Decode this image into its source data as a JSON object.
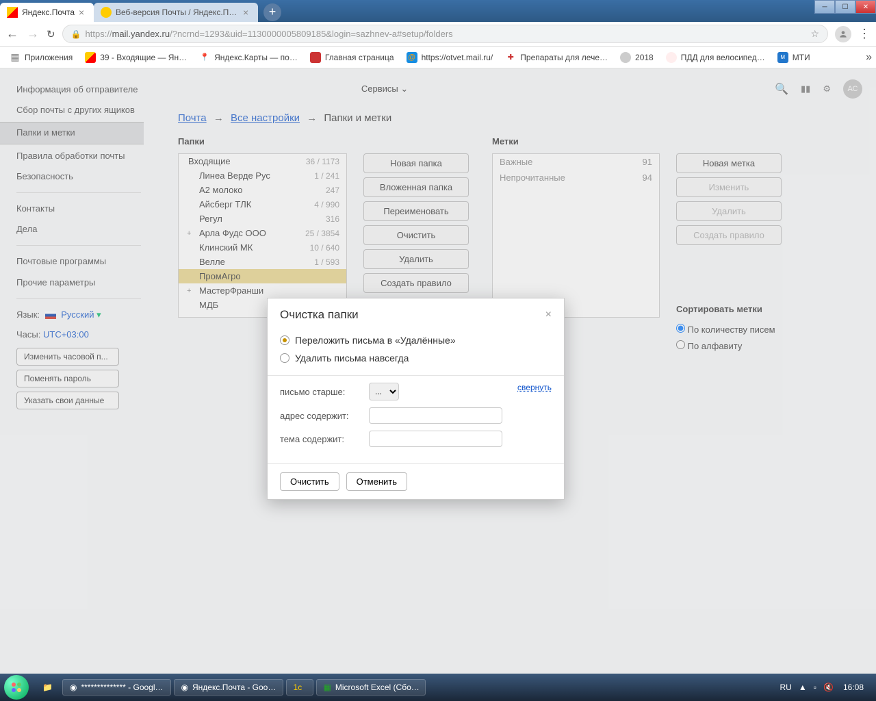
{
  "browser": {
    "tabs": [
      {
        "title": "Яндекс.Почта",
        "active": true
      },
      {
        "title": "Веб-версия Почты / Яндекс.По…",
        "active": false
      }
    ],
    "url_prefix": "https://",
    "url_host": "mail.yandex.ru",
    "url_path": "/?ncrnd=1293&uid=1130000005809185&login=sazhnev-a#setup/folders",
    "bookmarks_label": "Приложения",
    "bookmarks": [
      {
        "label": "39 - Входящие — Ян…"
      },
      {
        "label": "Яндекс.Карты — по…"
      },
      {
        "label": "Главная страница"
      },
      {
        "label": "https://otvet.mail.ru/"
      },
      {
        "label": "Препараты для лече…"
      },
      {
        "label": "2018"
      },
      {
        "label": "ПДД для велосипед…"
      },
      {
        "label": "МТИ"
      }
    ]
  },
  "topbar": {
    "services": "Сервисы",
    "avatar": "АС"
  },
  "breadcrumb": {
    "mail": "Почта",
    "all_settings": "Все настройки",
    "current": "Папки и метки"
  },
  "sidebar": {
    "items": [
      "Информация об отправителе",
      "Сбор почты с других ящиков",
      "Папки и метки",
      "Правила обработки почты",
      "Безопасность",
      "Контакты",
      "Дела",
      "Почтовые программы",
      "Прочие параметры"
    ],
    "lang_label": "Язык:",
    "lang_value": "Русский",
    "clock_label": "Часы:",
    "clock_value": "UTC+03:00",
    "btn_tz": "Изменить часовой п...",
    "btn_pass": "Поменять пароль",
    "btn_data": "Указать свои данные"
  },
  "sections": {
    "folders": "Папки",
    "labels": "Метки",
    "sort_title": "Сортировать метки",
    "sort_by_count": "По количеству писем",
    "sort_alpha": "По алфавиту"
  },
  "folder_buttons": [
    "Новая папка",
    "Вложенная папка",
    "Переименовать",
    "Очистить",
    "Удалить",
    "Создать правило"
  ],
  "label_buttons": [
    "Новая метка",
    "Изменить",
    "Удалить",
    "Создать правило"
  ],
  "folders": [
    {
      "name": "Входящие",
      "count": "36 / 1173",
      "level": 0
    },
    {
      "name": "Линеа Верде Рус",
      "count": "1 / 241",
      "level": 1
    },
    {
      "name": "А2 молоко",
      "count": "247",
      "level": 1
    },
    {
      "name": "Айсберг ТЛК",
      "count": "4 / 990",
      "level": 1
    },
    {
      "name": "Регул",
      "count": "316",
      "level": 1
    },
    {
      "name": "Арла Фудс ООО",
      "count": "25 / 3854",
      "level": 1,
      "expand": "+"
    },
    {
      "name": "Клинский МК",
      "count": "10 / 640",
      "level": 1
    },
    {
      "name": "Велле",
      "count": "1 / 593",
      "level": 1
    },
    {
      "name": "ПромАгро",
      "count": "",
      "level": 1,
      "selected": true
    },
    {
      "name": "МастерФранши",
      "count": "",
      "level": 1,
      "expand": "+"
    },
    {
      "name": "МДБ",
      "count": "",
      "level": 1
    }
  ],
  "labels": [
    {
      "name": "Важные",
      "count": "91"
    },
    {
      "name": "Непрочитанные",
      "count": "94"
    }
  ],
  "modal": {
    "title": "Очистка папки",
    "opt_move": "Переложить письма в «Удалённые»",
    "opt_delete": "Удалить письма навсегда",
    "collapse": "свернуть",
    "older_than": "письмо старше:",
    "older_val": "...",
    "addr_contains": "адрес содержит:",
    "subj_contains": "тема содержит:",
    "btn_clean": "Очистить",
    "btn_cancel": "Отменить"
  },
  "taskbar": {
    "items": [
      "************** - Googl…",
      "Яндекс.Почта - Goo…",
      "",
      "Microsoft Excel (Сбо…"
    ],
    "lang": "RU",
    "time": "16:08"
  }
}
